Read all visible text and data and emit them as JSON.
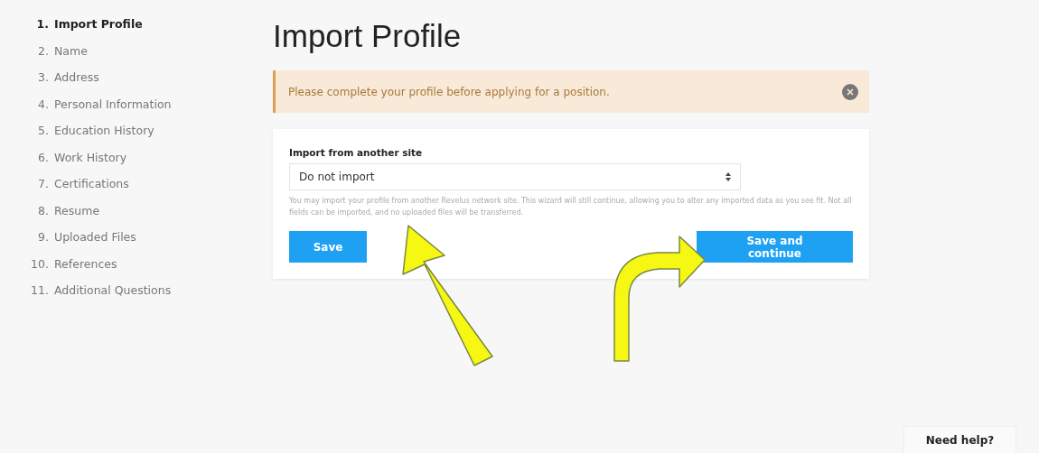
{
  "steps": [
    {
      "number": "1.",
      "label": "Import Profile",
      "selected": true
    },
    {
      "number": "2.",
      "label": "Name",
      "selected": false
    },
    {
      "number": "3.",
      "label": "Address",
      "selected": false
    },
    {
      "number": "4.",
      "label": "Personal Information",
      "selected": false
    },
    {
      "number": "5.",
      "label": "Education History",
      "selected": false
    },
    {
      "number": "6.",
      "label": "Work History",
      "selected": false
    },
    {
      "number": "7.",
      "label": "Certifications",
      "selected": false
    },
    {
      "number": "8.",
      "label": "Resume",
      "selected": false
    },
    {
      "number": "9.",
      "label": "Uploaded Files",
      "selected": false
    },
    {
      "number": "10.",
      "label": "References",
      "selected": false
    },
    {
      "number": "11.",
      "label": "Additional Questions",
      "selected": false
    }
  ],
  "page_title": "Import Profile",
  "alert": {
    "message": "Please complete your profile before applying for a position."
  },
  "form": {
    "label": "Import from another site",
    "select_value": "Do not import",
    "help": "You may import your profile from another Revelus network site. This wizard will still continue, allowing you to alter any imported data as you see fit. Not all fields can be imported, and no uploaded files will be transferred.",
    "buttons": [
      "Save",
      "Save and continue"
    ]
  },
  "help_button": "Need help?"
}
